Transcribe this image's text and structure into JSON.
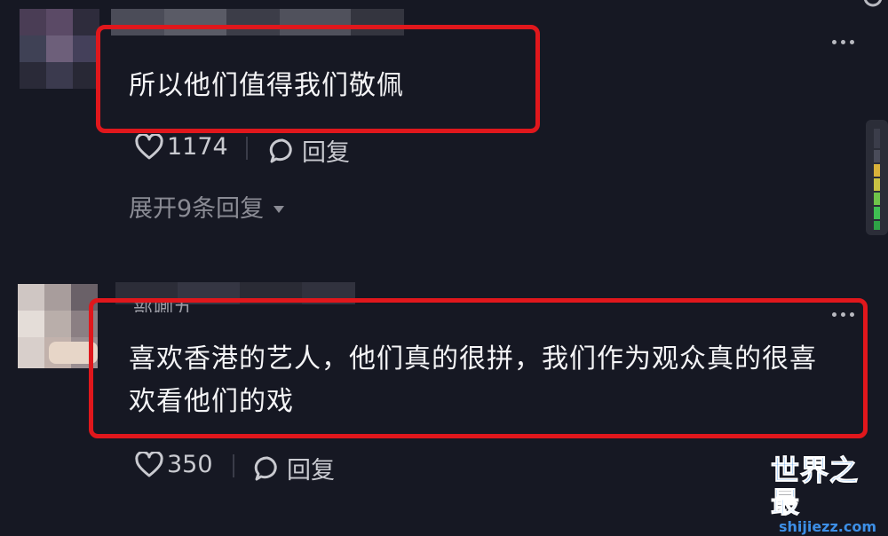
{
  "comments": [
    {
      "text": "所以他们值得我们敬佩",
      "likes": "1174",
      "reply_label": "回复",
      "expand_label": "展开9条回复"
    },
    {
      "username": "部卿九",
      "text_line1": "喜欢香港的艺人，他们真的很拼，我们作为观众真的很喜",
      "text_line2": "欢看他们的戏",
      "likes": "350",
      "reply_label": "回复"
    }
  ],
  "watermark": {
    "title": "世界之最",
    "url": "shijiezz.com"
  },
  "colors": {
    "background": "#161823",
    "highlight_box": "#e0171c",
    "watermark": "#3d8fe6"
  },
  "icons": [
    "heart-icon",
    "comment-bubble-icon",
    "more-icon",
    "chevron-down-icon",
    "search-icon"
  ]
}
